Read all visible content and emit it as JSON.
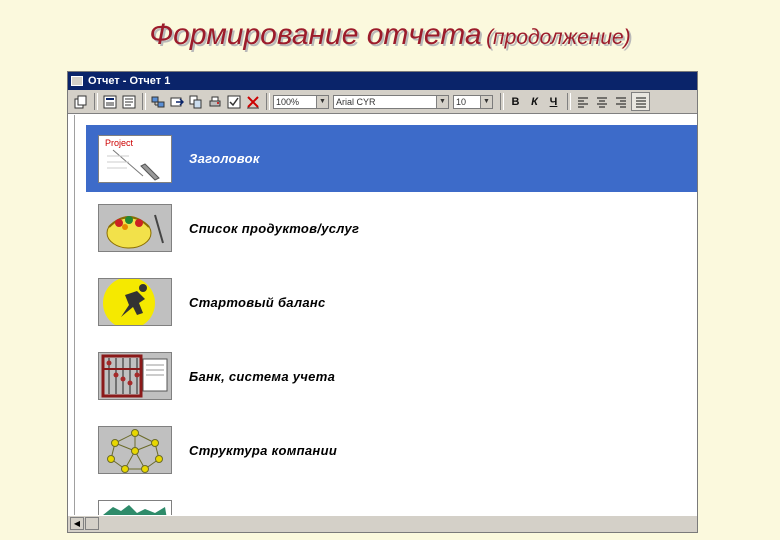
{
  "slide": {
    "title": "Формирование отчета",
    "subtitle": "(продолжение)"
  },
  "window": {
    "title": "Отчет - Отчет 1"
  },
  "toolbar": {
    "zoom_value": "100%",
    "font_value": "Arial CYR",
    "size_value": "10",
    "bold_label": "В",
    "italic_label": "К",
    "underline_label": "Ч"
  },
  "items": [
    {
      "label": "Заголовок",
      "icon": "project-document-icon",
      "thumb_text": "Project",
      "selected": true
    },
    {
      "label": "Список продуктов/услуг",
      "icon": "basket-icon",
      "selected": false
    },
    {
      "label": "Стартовый баланс",
      "icon": "runner-icon",
      "selected": false
    },
    {
      "label": "Банк, система учета",
      "icon": "abacus-icon",
      "selected": false
    },
    {
      "label": "Структура компании",
      "icon": "network-structure-icon",
      "selected": false
    },
    {
      "label": "",
      "icon": "map-icon",
      "selected": false
    }
  ],
  "colors": {
    "background": "#fbf9dd",
    "title": "#9c1b2a",
    "selection": "#3d6bc9",
    "window_title": "#0a246a"
  }
}
